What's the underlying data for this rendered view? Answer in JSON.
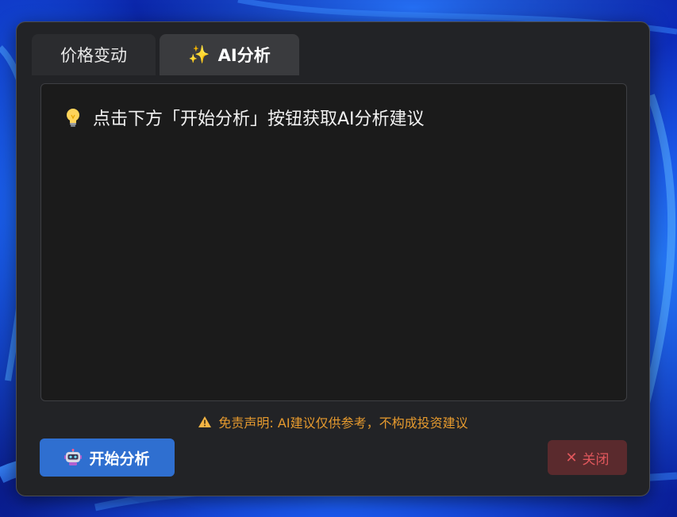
{
  "tabs": [
    {
      "label": "价格变动",
      "active": false
    },
    {
      "label": "AI分析",
      "active": true,
      "icon": "sparkles-icon"
    }
  ],
  "panel": {
    "hint_icon": "lightbulb-icon",
    "hint_text": "点击下方「开始分析」按钮获取AI分析建议"
  },
  "disclaimer": {
    "icon": "warning-icon",
    "text": "免责声明: AI建议仅供参考，不构成投资建议"
  },
  "buttons": {
    "start": {
      "label": "开始分析",
      "icon": "robot-icon"
    },
    "close": {
      "label": "关闭",
      "icon": "close-icon"
    }
  },
  "colors": {
    "accent_blue": "#2f6fd0",
    "warning_orange": "#e69a2e",
    "close_red": "#e0575c",
    "window_bg": "#222326",
    "panel_bg": "#1b1b1b"
  }
}
